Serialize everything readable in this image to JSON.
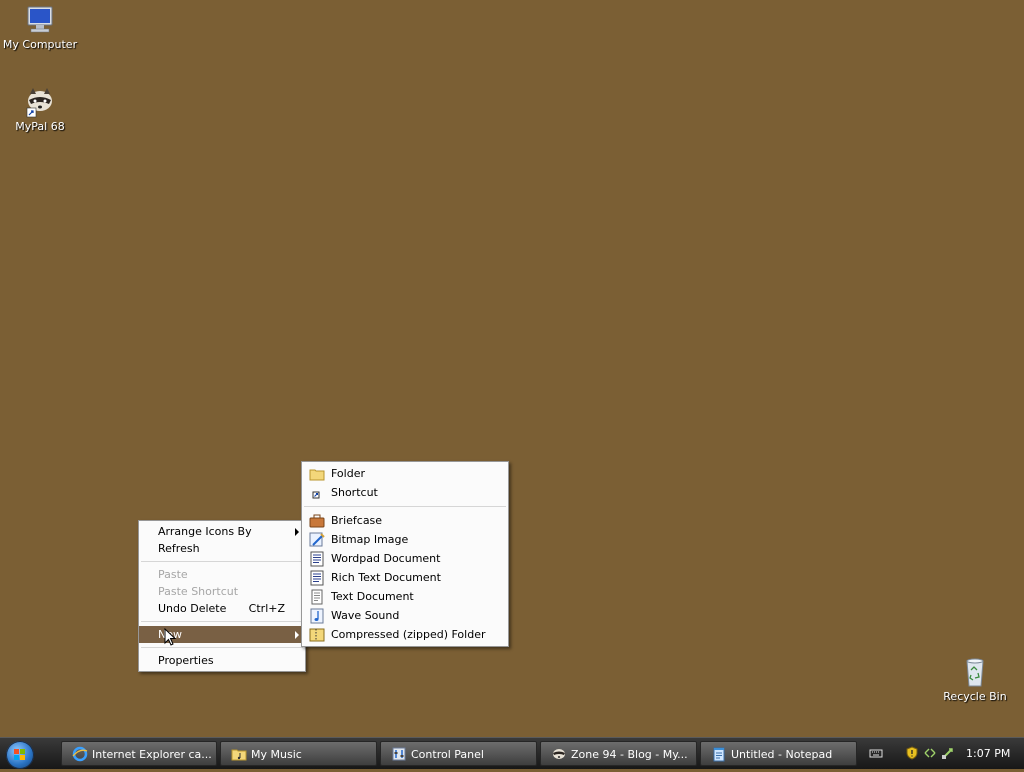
{
  "desktop": {
    "icons": [
      {
        "label": "My Computer",
        "icon": "computer-icon"
      },
      {
        "label": "MyPal 68",
        "icon": "mypal-raccoon-icon"
      },
      {
        "label": "Recycle Bin",
        "icon": "recycle-bin-icon"
      }
    ]
  },
  "context_menu": {
    "items": {
      "arrange": "Arrange Icons By",
      "refresh": "Refresh",
      "paste": "Paste",
      "paste_shortcut": "Paste Shortcut",
      "undo_delete": "Undo Delete",
      "undo_delete_accel": "Ctrl+Z",
      "new": "New",
      "properties": "Properties"
    },
    "highlighted": "New"
  },
  "new_submenu": {
    "items": [
      {
        "label": "Folder",
        "icon": "folder-icon"
      },
      {
        "label": "Shortcut",
        "icon": "shortcut-icon"
      },
      {
        "label": "Briefcase",
        "icon": "briefcase-icon"
      },
      {
        "label": "Bitmap Image",
        "icon": "bitmap-image-icon"
      },
      {
        "label": "Wordpad Document",
        "icon": "wordpad-document-icon"
      },
      {
        "label": "Rich Text Document",
        "icon": "rich-text-document-icon"
      },
      {
        "label": "Text Document",
        "icon": "text-document-icon"
      },
      {
        "label": "Wave Sound",
        "icon": "wave-sound-icon"
      },
      {
        "label": "Compressed (zipped) Folder",
        "icon": "zipped-folder-icon"
      }
    ]
  },
  "taskbar": {
    "tasks": [
      {
        "label": "Internet Explorer ca...",
        "icon": "internet-explorer-icon"
      },
      {
        "label": "My Music",
        "icon": "music-folder-icon"
      },
      {
        "label": "Control Panel",
        "icon": "control-panel-icon"
      },
      {
        "label": "Zone 94 - Blog - My...",
        "icon": "mypal-raccoon-icon"
      },
      {
        "label": "Untitled - Notepad",
        "icon": "notepad-icon"
      }
    ],
    "clock": "1:07 PM"
  },
  "colors": {
    "desktop_background": "#7b5f34",
    "menu_highlight": "#796044"
  }
}
